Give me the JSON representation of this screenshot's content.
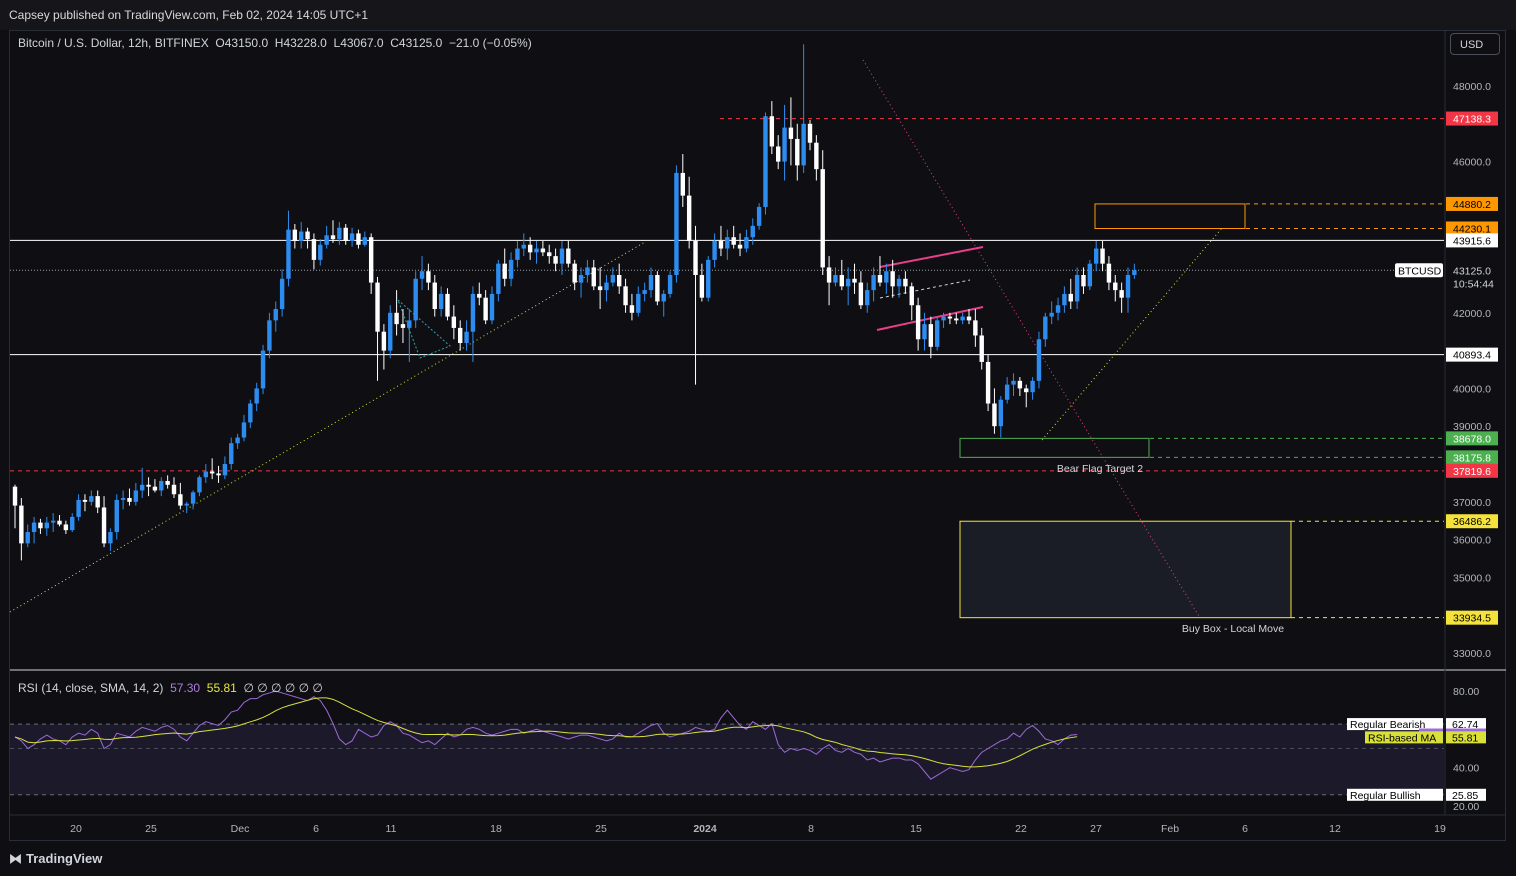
{
  "header": {
    "publisher": "Capsey published on TradingView.com, Feb 02, 2024 14:05 UTC+1",
    "currency_button": "USD",
    "footer_brand": "TradingView"
  },
  "legend": {
    "symbol": "Bitcoin / U.S. Dollar, 12h, BITFINEX",
    "open": "O43150.0",
    "high": "H43228.0",
    "low": "L43067.0",
    "close": "C43125.0",
    "change": "−21.0 (−0.05%)"
  },
  "rsi_legend": {
    "label": "RSI (14, close, SMA, 14, 2)",
    "rsi_value": "57.30",
    "ma_value": "55.81",
    "extras": "∅ ∅ ∅ ∅ ∅ ∅"
  },
  "colors": {
    "background": "#0f0f13",
    "bull_candle": "#2d8cf0",
    "bear_candle": "#ffffff",
    "red_level": "#f23645",
    "orange_level": "#ff9800",
    "green_level": "#4caf50",
    "yellow_level": "#f5e33c",
    "rsi_line": "#9c6ad8",
    "rsi_ma": "#d8e03a",
    "flag_lines": "#e83e8c"
  },
  "price_axis_ticks": [
    "48000.0",
    "46000.0",
    "42000.0",
    "40000.0",
    "39000.0",
    "37000.0",
    "36000.0",
    "35000.0",
    "33000.0"
  ],
  "price_labels": [
    {
      "text": "47138.3",
      "kind": "red"
    },
    {
      "text": "44880.2",
      "kind": "orange"
    },
    {
      "text": "44230.1",
      "kind": "orange"
    },
    {
      "text": "43915.6",
      "kind": "white"
    },
    {
      "text": "40893.4",
      "kind": "white"
    },
    {
      "text": "38678.0",
      "kind": "green"
    },
    {
      "text": "38175.8",
      "kind": "green"
    },
    {
      "text": "37819.6",
      "kind": "red"
    },
    {
      "text": "36486.2",
      "kind": "yellow"
    },
    {
      "text": "33934.5",
      "kind": "yellow"
    }
  ],
  "current_price": {
    "symbol": "BTCUSD",
    "price": "43125.0",
    "countdown": "10:54:44"
  },
  "rsi_axis_ticks": [
    "80.00",
    "40.00",
    "20.00"
  ],
  "rsi_labels": [
    {
      "tag": "Regular Bearish",
      "value": "62.74",
      "kind": "white"
    },
    {
      "tag": "RSI",
      "value": "57.30",
      "kind": "purple"
    },
    {
      "tag": "RSI-based MA",
      "value": "55.81",
      "kind": "yellow"
    },
    {
      "tag": "Regular Bullish",
      "value": "25.85",
      "kind": "white"
    }
  ],
  "time_axis_ticks": [
    "20",
    "25",
    "Dec",
    "6",
    "11",
    "18",
    "25",
    "2024",
    "8",
    "15",
    "22",
    "27",
    "Feb",
    "6",
    "12",
    "19"
  ],
  "annotations": {
    "bear_flag_target": "Bear Flag Target 2",
    "buy_box": "Buy Box - Local Move"
  },
  "chart_data": {
    "type": "candlestick",
    "symbol": "BTCUSD",
    "interval": "12h",
    "exchange": "BITFINEX",
    "ylim": [
      32500,
      49500
    ],
    "levels": [
      47138.3,
      44880.2,
      44230.1,
      43915.6,
      40893.4,
      38678.0,
      38175.8,
      37819.6,
      36486.2,
      33934.5
    ],
    "ohlc": [
      [
        37400,
        37450,
        36300,
        36900
      ],
      [
        36900,
        37100,
        35450,
        35900
      ],
      [
        35900,
        36400,
        35800,
        36200
      ],
      [
        36200,
        36600,
        35900,
        36450
      ],
      [
        36450,
        36550,
        36150,
        36300
      ],
      [
        36300,
        36600,
        36100,
        36450
      ],
      [
        36450,
        36700,
        36200,
        36500
      ],
      [
        36500,
        36650,
        36350,
        36400
      ],
      [
        36400,
        36500,
        36150,
        36250
      ],
      [
        36250,
        36700,
        36200,
        36600
      ],
      [
        36600,
        37200,
        36500,
        37050
      ],
      [
        37050,
        37200,
        36750,
        37000
      ],
      [
        37000,
        37300,
        36900,
        37150
      ],
      [
        37150,
        37300,
        36700,
        36850
      ],
      [
        36850,
        37150,
        35800,
        35900
      ],
      [
        35900,
        36300,
        35700,
        36200
      ],
      [
        36200,
        37200,
        36000,
        37050
      ],
      [
        37050,
        37300,
        36800,
        37100
      ],
      [
        37100,
        37350,
        36900,
        37000
      ],
      [
        37000,
        37500,
        36900,
        37300
      ],
      [
        37300,
        37900,
        37100,
        37450
      ],
      [
        37450,
        37650,
        37150,
        37400
      ],
      [
        37400,
        37600,
        37250,
        37300
      ],
      [
        37300,
        37650,
        37150,
        37550
      ],
      [
        37550,
        37700,
        37350,
        37450
      ],
      [
        37450,
        37650,
        37100,
        37200
      ],
      [
        37200,
        37500,
        36800,
        36900
      ],
      [
        36900,
        37000,
        36700,
        36950
      ],
      [
        36950,
        37300,
        36800,
        37250
      ],
      [
        37250,
        37700,
        37150,
        37650
      ],
      [
        37650,
        38000,
        37500,
        37800
      ],
      [
        37800,
        38150,
        37600,
        37750
      ],
      [
        37750,
        37950,
        37500,
        37700
      ],
      [
        37700,
        38200,
        37600,
        38000
      ],
      [
        38000,
        38700,
        37850,
        38550
      ],
      [
        38550,
        38800,
        38400,
        38700
      ],
      [
        38700,
        39300,
        38600,
        39100
      ],
      [
        39100,
        39700,
        38950,
        39600
      ],
      [
        39600,
        40150,
        39400,
        40000
      ],
      [
        40000,
        41150,
        39850,
        41000
      ],
      [
        41000,
        42000,
        40800,
        41800
      ],
      [
        41800,
        42300,
        41500,
        42100
      ],
      [
        42100,
        43150,
        41900,
        42900
      ],
      [
        42900,
        44700,
        42700,
        44200
      ],
      [
        44200,
        44350,
        43700,
        43900
      ],
      [
        43900,
        44400,
        43700,
        44150
      ],
      [
        44150,
        44250,
        43700,
        43950
      ],
      [
        43950,
        44100,
        43150,
        43400
      ],
      [
        43400,
        43950,
        43250,
        43800
      ],
      [
        43800,
        44300,
        43700,
        44050
      ],
      [
        44050,
        44450,
        43850,
        43950
      ],
      [
        43950,
        44400,
        43800,
        44250
      ],
      [
        44250,
        44350,
        43800,
        43900
      ],
      [
        43900,
        44250,
        43750,
        44100
      ],
      [
        44100,
        44200,
        43700,
        43800
      ],
      [
        43800,
        44150,
        43750,
        44000
      ],
      [
        44000,
        44100,
        42500,
        42800
      ],
      [
        42800,
        42950,
        40200,
        41500
      ],
      [
        41500,
        41700,
        40500,
        41000
      ],
      [
        41000,
        42200,
        40800,
        42000
      ],
      [
        42000,
        42600,
        41400,
        41700
      ],
      [
        41700,
        42100,
        41200,
        41600
      ],
      [
        41600,
        42100,
        40700,
        41800
      ],
      [
        41800,
        43100,
        41600,
        42900
      ],
      [
        42900,
        43500,
        42600,
        43100
      ],
      [
        43100,
        43300,
        42600,
        42800
      ],
      [
        42800,
        43000,
        41900,
        42100
      ],
      [
        42100,
        42700,
        41900,
        42500
      ],
      [
        42500,
        42650,
        41800,
        41900
      ],
      [
        41900,
        42200,
        41300,
        41600
      ],
      [
        41600,
        41800,
        41000,
        41200
      ],
      [
        41200,
        41800,
        41000,
        41500
      ],
      [
        41500,
        42700,
        40700,
        42500
      ],
      [
        42500,
        42800,
        42200,
        42400
      ],
      [
        42400,
        42600,
        41700,
        41800
      ],
      [
        41800,
        42700,
        41700,
        42500
      ],
      [
        42500,
        43400,
        42300,
        43300
      ],
      [
        43300,
        43700,
        42700,
        42900
      ],
      [
        42900,
        43600,
        42700,
        43400
      ],
      [
        43400,
        43900,
        43200,
        43700
      ],
      [
        43700,
        44100,
        43500,
        43800
      ],
      [
        43800,
        44000,
        43400,
        43600
      ],
      [
        43600,
        43900,
        43300,
        43700
      ],
      [
        43700,
        43900,
        43500,
        43600
      ],
      [
        43600,
        43800,
        43300,
        43500
      ],
      [
        43500,
        43700,
        43100,
        43300
      ],
      [
        43300,
        43900,
        43000,
        43700
      ],
      [
        43700,
        43900,
        43200,
        43300
      ],
      [
        43300,
        43400,
        42600,
        42800
      ],
      [
        42800,
        43200,
        42400,
        43000
      ],
      [
        43000,
        43400,
        42800,
        43200
      ],
      [
        43200,
        43400,
        42600,
        42700
      ],
      [
        42700,
        43200,
        42100,
        42600
      ],
      [
        42600,
        43000,
        42300,
        42800
      ],
      [
        42800,
        43200,
        42700,
        43000
      ],
      [
        43000,
        43300,
        42500,
        42700
      ],
      [
        42700,
        42900,
        42000,
        42200
      ],
      [
        42200,
        42500,
        41800,
        42000
      ],
      [
        42000,
        42700,
        41900,
        42500
      ],
      [
        42500,
        42800,
        42300,
        42600
      ],
      [
        42600,
        43200,
        42400,
        43000
      ],
      [
        43000,
        43100,
        42200,
        42300
      ],
      [
        42300,
        42600,
        41900,
        42500
      ],
      [
        42500,
        43100,
        42400,
        43000
      ],
      [
        43000,
        45900,
        42800,
        45700
      ],
      [
        45700,
        46200,
        44800,
        45100
      ],
      [
        45100,
        45600,
        43700,
        43900
      ],
      [
        43900,
        44300,
        40100,
        43000
      ],
      [
        43000,
        43300,
        42300,
        42400
      ],
      [
        42400,
        43500,
        42300,
        43400
      ],
      [
        43400,
        44100,
        43200,
        43900
      ],
      [
        43900,
        44300,
        43500,
        43700
      ],
      [
        43700,
        44200,
        43400,
        44000
      ],
      [
        44000,
        44300,
        43700,
        43800
      ],
      [
        43800,
        44100,
        43500,
        43700
      ],
      [
        43700,
        44200,
        43600,
        44000
      ],
      [
        44000,
        44500,
        43800,
        44300
      ],
      [
        44300,
        44900,
        44200,
        44800
      ],
      [
        44800,
        47300,
        44600,
        47200
      ],
      [
        47200,
        47600,
        46200,
        46400
      ],
      [
        46400,
        46700,
        45800,
        46000
      ],
      [
        46000,
        47500,
        45500,
        46900
      ],
      [
        46900,
        47700,
        45900,
        46600
      ],
      [
        46600,
        47000,
        45500,
        45900
      ],
      [
        45900,
        49100,
        45700,
        47000
      ],
      [
        47000,
        47100,
        46300,
        46500
      ],
      [
        46500,
        46700,
        45500,
        45800
      ],
      [
        45800,
        46300,
        43000,
        43200
      ],
      [
        43200,
        43500,
        42200,
        42800
      ],
      [
        42800,
        43200,
        42700,
        43000
      ],
      [
        43000,
        43400,
        42600,
        42700
      ],
      [
        42700,
        43200,
        42200,
        42900
      ],
      [
        42900,
        43300,
        42500,
        42800
      ],
      [
        42800,
        43100,
        42100,
        42200
      ],
      [
        42200,
        42800,
        42000,
        42600
      ],
      [
        42600,
        43200,
        42300,
        43000
      ],
      [
        43000,
        43500,
        42700,
        42800
      ],
      [
        42800,
        43300,
        42500,
        43100
      ],
      [
        43100,
        43400,
        42400,
        42700
      ],
      [
        42700,
        43000,
        42400,
        42900
      ],
      [
        42900,
        43100,
        42500,
        42700
      ],
      [
        42700,
        42800,
        41800,
        42200
      ],
      [
        42200,
        42400,
        41000,
        41300
      ],
      [
        41300,
        42000,
        41000,
        41700
      ],
      [
        41700,
        41900,
        40800,
        41100
      ],
      [
        41100,
        41900,
        41000,
        41800
      ],
      [
        41800,
        42000,
        41600,
        41900
      ],
      [
        41900,
        42000,
        41700,
        41850
      ],
      [
        41850,
        42000,
        41700,
        41800
      ],
      [
        41800,
        42000,
        41700,
        41900
      ],
      [
        41900,
        42100,
        41700,
        41800
      ],
      [
        41800,
        42100,
        41100,
        41400
      ],
      [
        41400,
        41600,
        40500,
        40700
      ],
      [
        40700,
        40900,
        39400,
        39600
      ],
      [
        39600,
        40000,
        38800,
        39000
      ],
      [
        39000,
        39800,
        38700,
        39700
      ],
      [
        39700,
        40300,
        39600,
        40100
      ],
      [
        40100,
        40400,
        39800,
        40200
      ],
      [
        40200,
        40300,
        39800,
        40000
      ],
      [
        40000,
        40100,
        39500,
        39900
      ],
      [
        39900,
        40300,
        39700,
        40200
      ],
      [
        40200,
        41500,
        40000,
        41300
      ],
      [
        41300,
        42000,
        41100,
        41900
      ],
      [
        41900,
        42300,
        41700,
        42000
      ],
      [
        42000,
        42400,
        41800,
        42200
      ],
      [
        42200,
        42700,
        42000,
        42500
      ],
      [
        42500,
        42900,
        42100,
        42300
      ],
      [
        42300,
        43200,
        42100,
        43000
      ],
      [
        43000,
        43200,
        42500,
        42700
      ],
      [
        42700,
        43400,
        42600,
        43300
      ],
      [
        43300,
        43900,
        43100,
        43700
      ],
      [
        43700,
        43900,
        43100,
        43300
      ],
      [
        43300,
        43500,
        42600,
        42800
      ],
      [
        42800,
        43000,
        42300,
        42600
      ],
      [
        42600,
        42800,
        42000,
        42400
      ],
      [
        42400,
        43200,
        42000,
        43000
      ],
      [
        43000,
        43300,
        42900,
        43125
      ]
    ],
    "rsi": [
      [
        56,
        54,
        50,
        52,
        55,
        57,
        55,
        54,
        52,
        56,
        58,
        57,
        60,
        58,
        50,
        52,
        58,
        57,
        56,
        59,
        61,
        60,
        59,
        61,
        62,
        60,
        56,
        54,
        58,
        62,
        64,
        63,
        62,
        65,
        69,
        70,
        74,
        76,
        76,
        78,
        79,
        80,
        79,
        78,
        77,
        76,
        75,
        77,
        75,
        70,
        63,
        55,
        52,
        54,
        60,
        58,
        56,
        57,
        62,
        64,
        62,
        58,
        57,
        55,
        53,
        54,
        52,
        55,
        58,
        56,
        57,
        60,
        61,
        60,
        58,
        57,
        58,
        59,
        60,
        60,
        58,
        59,
        60,
        59,
        58,
        57,
        56,
        55,
        56,
        57,
        57,
        56,
        55,
        54,
        55,
        58,
        56,
        56,
        58,
        60,
        62,
        63,
        58,
        56,
        57,
        58,
        59,
        61,
        60,
        59,
        60,
        66,
        70,
        66,
        62,
        60,
        64,
        62,
        60,
        63,
        52,
        48,
        50,
        49,
        50,
        49,
        47,
        50,
        52,
        49,
        48,
        50,
        48,
        47,
        44,
        45,
        43,
        44,
        45,
        45,
        44,
        44,
        42,
        38,
        34,
        36,
        38,
        40,
        39,
        38,
        39,
        44,
        48,
        50,
        52,
        54,
        55,
        58,
        56,
        60,
        62,
        59,
        55,
        54,
        52,
        55,
        57,
        57.3
      ]
    ],
    "rsi_ma_value": 55.81,
    "rsi_levels": [
      62.74,
      25.85
    ]
  }
}
